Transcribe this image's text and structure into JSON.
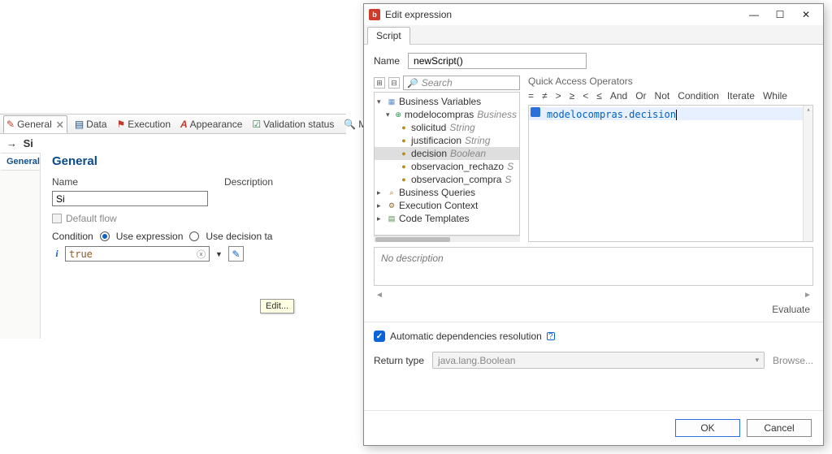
{
  "left": {
    "tabs": {
      "general": "General",
      "data": "Data",
      "execution": "Execution",
      "appearance": "Appearance",
      "validation": "Validation status",
      "minimap": "Minimap"
    },
    "breadcrumb": "Si",
    "sideTab": "General",
    "sectionTitle": "General",
    "nameLabel": "Name",
    "nameValue": "Si",
    "descLabel": "Description",
    "defaultFlow": "Default flow",
    "conditionLabel": "Condition",
    "radioUseExpr": "Use expression",
    "radioUseTable": "Use decision ta",
    "conditionValue": "true",
    "tooltip": "Edit..."
  },
  "dialog": {
    "title": "Edit expression",
    "tab": "Script",
    "nameLabel": "Name",
    "nameValue": "newScript()",
    "searchPlaceholder": "Search",
    "tree": {
      "root": "Business Variables",
      "model": "modelocompras",
      "modelType": "Business",
      "fields": [
        {
          "name": "solicitud",
          "type": "String"
        },
        {
          "name": "justificacion",
          "type": "String"
        },
        {
          "name": "decision",
          "type": "Boolean"
        },
        {
          "name": "observacion_rechazo",
          "type": "S"
        },
        {
          "name": "observacion_compra",
          "type": "S"
        }
      ],
      "queries": "Business Queries",
      "ctx": "Execution Context",
      "templates": "Code Templates"
    },
    "qaLabel": "Quick Access Operators",
    "ops": [
      "=",
      "≠",
      ">",
      "≥",
      "<",
      "≤",
      "And",
      "Or",
      "Not",
      "Condition",
      "Iterate",
      "While"
    ],
    "code": {
      "var": "modelocompras",
      "field": "decision"
    },
    "noDesc": "No description",
    "evaluate": "Evaluate",
    "autoLabel": "Automatic dependencies resolution",
    "returnLabel": "Return type",
    "returnValue": "java.lang.Boolean",
    "browse": "Browse...",
    "ok": "OK",
    "cancel": "Cancel",
    "winMin": "—",
    "winMax": "☐",
    "winClose": "✕"
  }
}
